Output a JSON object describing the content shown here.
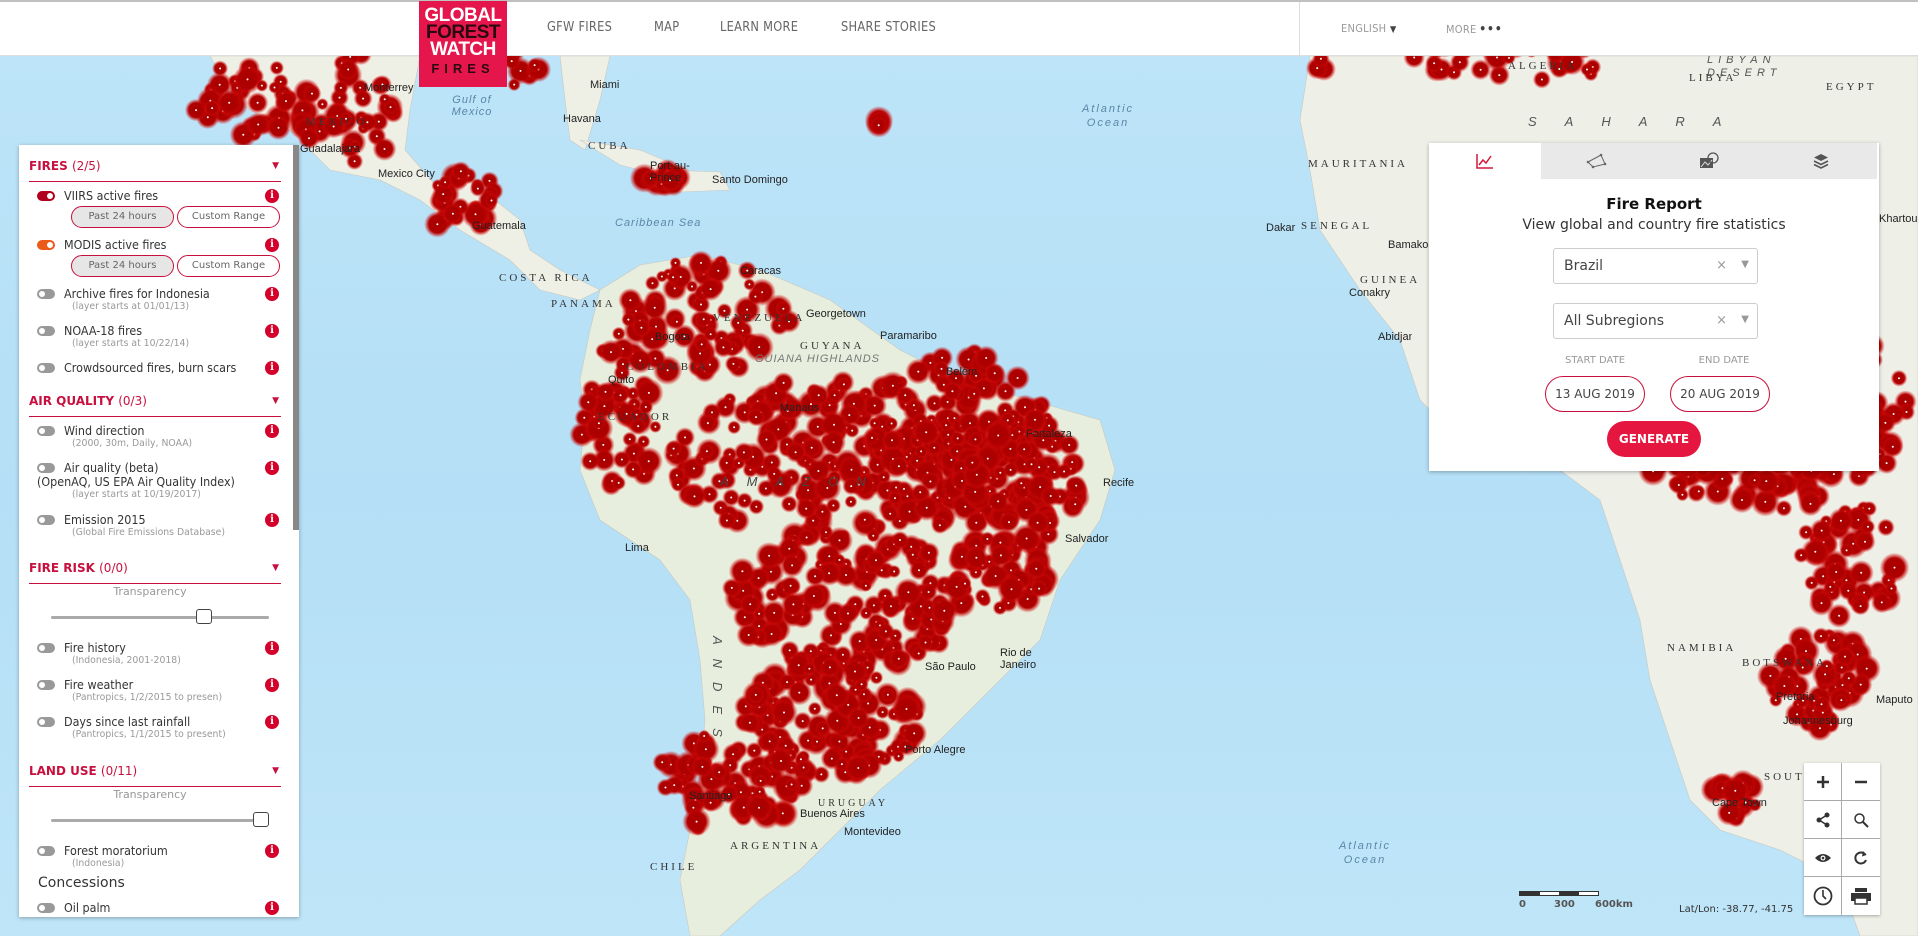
{
  "header": {
    "logo": [
      "GLOBAL",
      "FOREST",
      "WATCH",
      "FIRES"
    ],
    "nav": [
      "GFW FIRES",
      "MAP",
      "LEARN MORE",
      "SHARE STORIES"
    ],
    "language": "ENGLISH",
    "more": "MORE"
  },
  "layers": {
    "sections": [
      {
        "title": "FIRES",
        "count": "(2/5)"
      },
      {
        "title": "AIR QUALITY",
        "count": "(0/3)"
      },
      {
        "title": "FIRE RISK",
        "count": "(0/0)"
      },
      {
        "title": "LAND USE",
        "count": "(0/11)"
      }
    ],
    "fires": [
      {
        "name": "VIIRS active fires",
        "state": "on",
        "pills": [
          "Past 24 hours",
          "Custom Range"
        ],
        "active_pill": "Past 24 hours"
      },
      {
        "name": "MODIS active fires",
        "state": "on",
        "pills": [
          "Past 24 hours",
          "Custom Range"
        ],
        "active_pill": "Past 24 hours"
      },
      {
        "name": "Archive fires for Indonesia",
        "sub": "(layer starts at 01/01/13)",
        "state": "off"
      },
      {
        "name": "NOAA-18 fires",
        "sub": "(layer starts at 10/22/14)",
        "state": "off"
      },
      {
        "name": "Crowdsourced fires, burn scars",
        "state": "off"
      }
    ],
    "air_quality": [
      {
        "name": "Wind direction",
        "sub": "(2000, 30m, Daily, NOAA)",
        "state": "off"
      },
      {
        "name": "Air quality (beta)",
        "sub2": "(OpenAQ, US EPA Air Quality Index)",
        "sub": "(layer starts at 10/19/2017)",
        "state": "off"
      },
      {
        "name": "Emission 2015",
        "sub": "(Global Fire Emissions Database)",
        "state": "off"
      }
    ],
    "fire_risk": {
      "transparency_label": "Transparency",
      "transparency_value": 0.72,
      "items": [
        {
          "name": "Fire history",
          "sub": "(Indonesia, 2001-2018)",
          "state": "off"
        },
        {
          "name": "Fire weather",
          "sub": "(Pantropics, 1/2/2015 to presen)",
          "state": "off"
        },
        {
          "name": "Days since last rainfall",
          "sub": "(Pantropics, 1/1/2015 to present)",
          "state": "off"
        }
      ]
    },
    "land_use": {
      "transparency_label": "Transparency",
      "transparency_value": 1.0,
      "items": [
        {
          "name": "Forest moratorium",
          "sub": "(Indonesia)",
          "state": "off"
        }
      ],
      "concessions_label": "Concessions",
      "concessions": [
        {
          "name": "Oil palm",
          "state": "off"
        }
      ]
    },
    "info_glyph": "i"
  },
  "report": {
    "tabs": [
      "analysis-chart-icon",
      "draw-shape-icon",
      "basemap-icon",
      "layers-icon"
    ],
    "active_tab": 0,
    "title": "Fire Report",
    "subtitle": "View global and country fire statistics",
    "country": "Brazil",
    "subregion": "All Subregions",
    "clear_glyph": "×",
    "start_date_label": "START DATE",
    "end_date_label": "END DATE",
    "start_date": "13 AUG 2019",
    "end_date": "20 AUG 2019",
    "generate": "GENERATE"
  },
  "map": {
    "scale": [
      "0",
      "300",
      "600km"
    ],
    "coords": "Lat/Lon: -38.77, -41.75",
    "labels": {
      "cities": [
        "Monterrey",
        "Guadalajara",
        "Mexico City",
        "Guatemala",
        "Miami",
        "Havana",
        "Port-au-Prince",
        "Santo Domingo",
        "Caracas",
        "Georgetown",
        "Paramaribo",
        "Bogota",
        "Quito",
        "Lima",
        "Belém",
        "Manaus",
        "Fortaleza",
        "Recife",
        "Salvador",
        "Rio de Janeiro",
        "São Paulo",
        "Porto Alegre",
        "Santiago",
        "Buenos Aires",
        "Montevideo",
        "Dakar",
        "Bamako",
        "Conakry",
        "Abidjan",
        "Khartoum",
        "Pretoria",
        "Johannesburg",
        "Maputo",
        "Cape Town"
      ],
      "countries": [
        "MEXICO",
        "CUBA",
        "COSTA RICA",
        "PANAMA",
        "VENEZUELA",
        "GUYANA",
        "COLOMBIA",
        "ECUADOR",
        "ARGENTINA",
        "CHILE",
        "URUGUAY",
        "ALGERIA",
        "LIBYA",
        "EGYPT",
        "MAURITANIA",
        "SENEGAL",
        "GUINEA",
        "NAMIBIA",
        "BOTSWANA",
        "SOUTH AFRICA"
      ],
      "water": [
        "Gulf of Mexico",
        "Caribbean Sea",
        "Atlantic Ocean",
        "Atlantic Ocean"
      ],
      "regions": [
        "GUIANA HIGHLANDS",
        "AMAZON",
        "ANDES",
        "SAHARA",
        "LIBYAN DESERT"
      ]
    }
  }
}
